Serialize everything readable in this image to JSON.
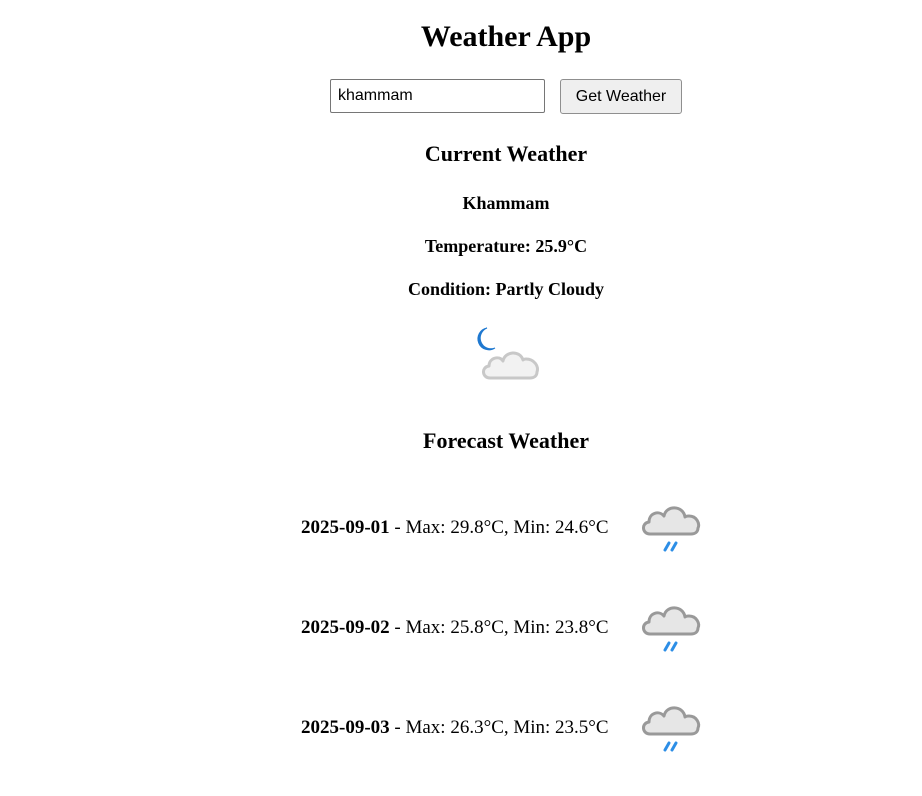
{
  "app": {
    "title": "Weather App"
  },
  "search": {
    "value": "khammam",
    "button_label": "Get Weather"
  },
  "current": {
    "section_title": "Current Weather",
    "city": "Khammam",
    "temperature_text": "Temperature: 25.9°C",
    "condition_text": "Condition: Partly Cloudy",
    "icon": "partly-cloudy-night-icon"
  },
  "forecast": {
    "section_title": "Forecast Weather",
    "days": [
      {
        "date": "2025-09-01",
        "details": " - Max: 29.8°C, Min: 24.6°C",
        "icon": "light-rain-icon"
      },
      {
        "date": "2025-09-02",
        "details": " - Max: 25.8°C, Min: 23.8°C",
        "icon": "light-rain-icon"
      },
      {
        "date": "2025-09-03",
        "details": " - Max: 26.3°C, Min: 23.5°C",
        "icon": "light-rain-icon"
      }
    ]
  },
  "colors": {
    "moon": "#1e78d0",
    "cloud_fill": "#f2f2f2",
    "cloud_stroke": "#c8c8c8",
    "rain_cloud_fill": "#e6e6e6",
    "rain_cloud_stroke": "#999999",
    "rain": "#2d8ee6"
  }
}
